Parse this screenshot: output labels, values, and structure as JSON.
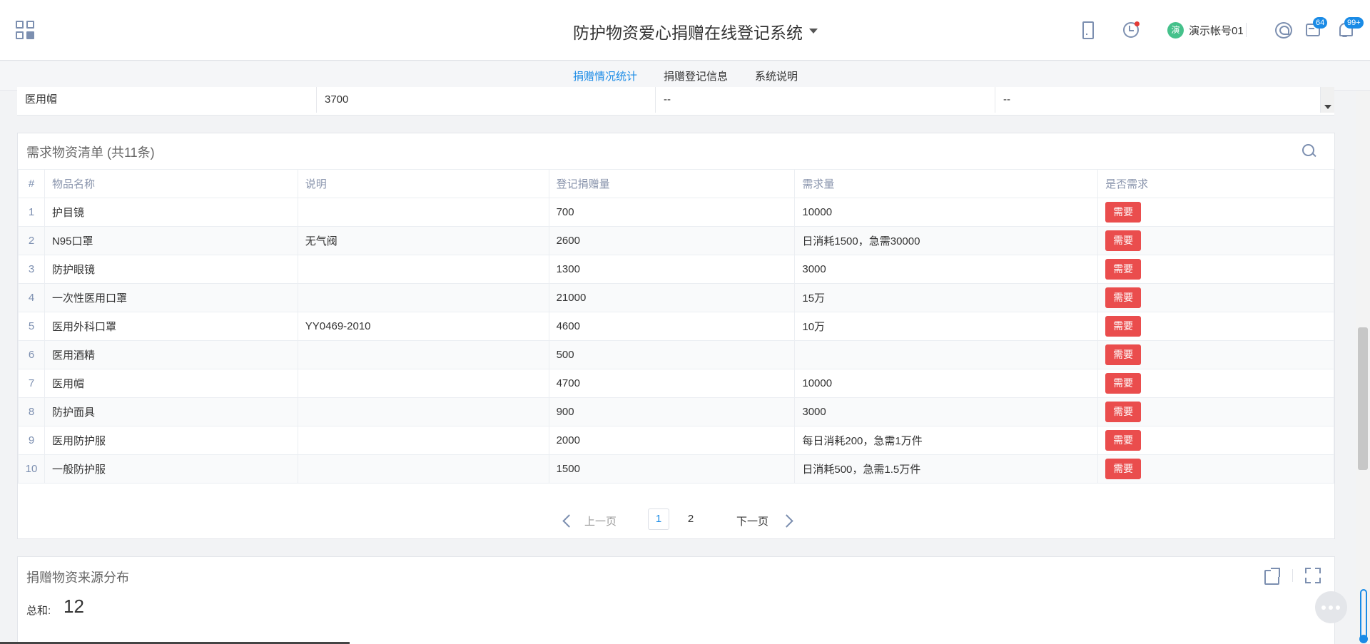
{
  "header": {
    "title": "防护物资爱心捐赠在线登记系统",
    "user_avatar_text": "演",
    "user_name": "演示帐号01",
    "msg_badge": "64",
    "bell_badge": "99+"
  },
  "tabs": [
    {
      "label": "捐赠情况统计",
      "active": true
    },
    {
      "label": "捐赠登记信息",
      "active": false
    },
    {
      "label": "系统说明",
      "active": false
    }
  ],
  "upper_row": {
    "name": "医用帽",
    "value": "3700",
    "c3": "--",
    "c4": "--"
  },
  "needs": {
    "title": "需求物资清单 (共11条)",
    "columns": [
      "#",
      "物品名称",
      "说明",
      "登记捐赠量",
      "需求量",
      "是否需求"
    ],
    "rows": [
      {
        "idx": "1",
        "name": "护目镜",
        "desc": "",
        "donated": "700",
        "demand": "10000",
        "need": "需要"
      },
      {
        "idx": "2",
        "name": "N95口罩",
        "desc": "无气阀",
        "donated": "2600",
        "demand": "日消耗1500，急需30000",
        "need": "需要"
      },
      {
        "idx": "3",
        "name": "防护眼镜",
        "desc": "",
        "donated": "1300",
        "demand": "3000",
        "need": "需要"
      },
      {
        "idx": "4",
        "name": "一次性医用口罩",
        "desc": "",
        "donated": "21000",
        "demand": "15万",
        "need": "需要"
      },
      {
        "idx": "5",
        "name": "医用外科口罩",
        "desc": "YY0469-2010",
        "donated": "4600",
        "demand": "10万",
        "need": "需要"
      },
      {
        "idx": "6",
        "name": "医用酒精",
        "desc": "",
        "donated": "500",
        "demand": "",
        "need": "需要"
      },
      {
        "idx": "7",
        "name": "医用帽",
        "desc": "",
        "donated": "4700",
        "demand": "10000",
        "need": "需要"
      },
      {
        "idx": "8",
        "name": "防护面具",
        "desc": "",
        "donated": "900",
        "demand": "3000",
        "need": "需要"
      },
      {
        "idx": "9",
        "name": "医用防护服",
        "desc": "",
        "donated": "2000",
        "demand": "每日消耗200，急需1万件",
        "need": "需要"
      },
      {
        "idx": "10",
        "name": "一般防护服",
        "desc": "",
        "donated": "1500",
        "demand": "日消耗500，急需1.5万件",
        "need": "需要"
      }
    ]
  },
  "pagination": {
    "prev": "上一页",
    "next": "下一页",
    "pages": [
      "1",
      "2"
    ],
    "current": "1"
  },
  "source": {
    "title": "捐赠物资来源分布",
    "total_label": "总和:",
    "total_value": "12"
  },
  "colors": {
    "accent": "#1a8be6",
    "need_button": "#ea4d4d",
    "avatar": "#45c18b"
  }
}
